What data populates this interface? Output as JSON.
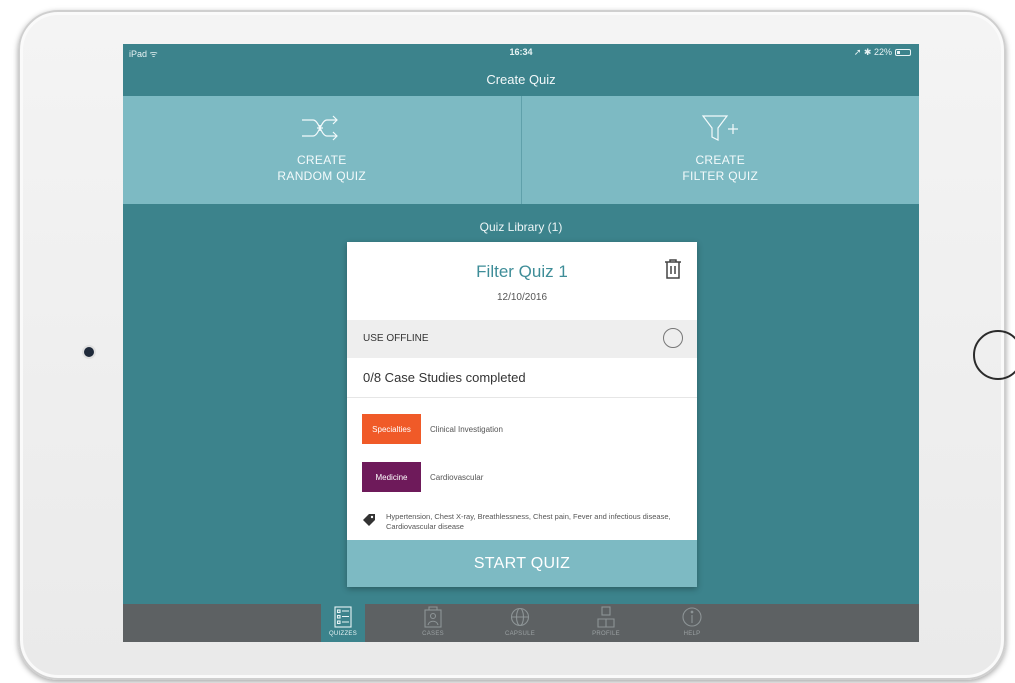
{
  "status_bar": {
    "left": "iPad ᯤ",
    "time": "16:34",
    "right": "➚ ✱ 22%",
    "battery_level": 0.22
  },
  "nav": {
    "title": "Create Quiz"
  },
  "create": {
    "random": {
      "line1": "CREATE",
      "line2": "RANDOM QUIZ",
      "icon": "shuffle-plus-icon"
    },
    "filter": {
      "line1": "CREATE",
      "line2": "FILTER QUIZ",
      "icon": "filter-plus-icon"
    }
  },
  "library": {
    "title": "Quiz Library (1)"
  },
  "quiz_card": {
    "title": "Filter Quiz 1",
    "date": "12/10/2016",
    "offline_label": "USE OFFLINE",
    "offline_enabled": false,
    "progress": "0/8 Case Studies completed",
    "tags": [
      {
        "badge": "Specialties",
        "value": "Clinical Investigation",
        "color": "#f05a28"
      },
      {
        "badge": "Medicine",
        "value": "Cardiovascular",
        "color": "#6e1a5a"
      }
    ],
    "keywords": "Hypertension, Chest X-ray, Breathlessness, Chest pain, Fever and infectious disease, Cardiovascular disease",
    "start_label": "START QUIZ"
  },
  "tabs": [
    {
      "label": "QUIZZES",
      "icon": "quiz-list-icon",
      "active": true
    },
    {
      "label": "CASES",
      "icon": "cases-icon",
      "active": false
    },
    {
      "label": "CAPSULE",
      "icon": "capsule-icon",
      "active": false
    },
    {
      "label": "PROFILE",
      "icon": "profile-icon",
      "active": false
    },
    {
      "label": "HELP",
      "icon": "help-icon",
      "active": false
    }
  ],
  "colors": {
    "screen_bg": "#3c838c",
    "panel": "#7dbac3",
    "title_accent": "#3e8d98",
    "tab_bar": "#5d6163"
  }
}
